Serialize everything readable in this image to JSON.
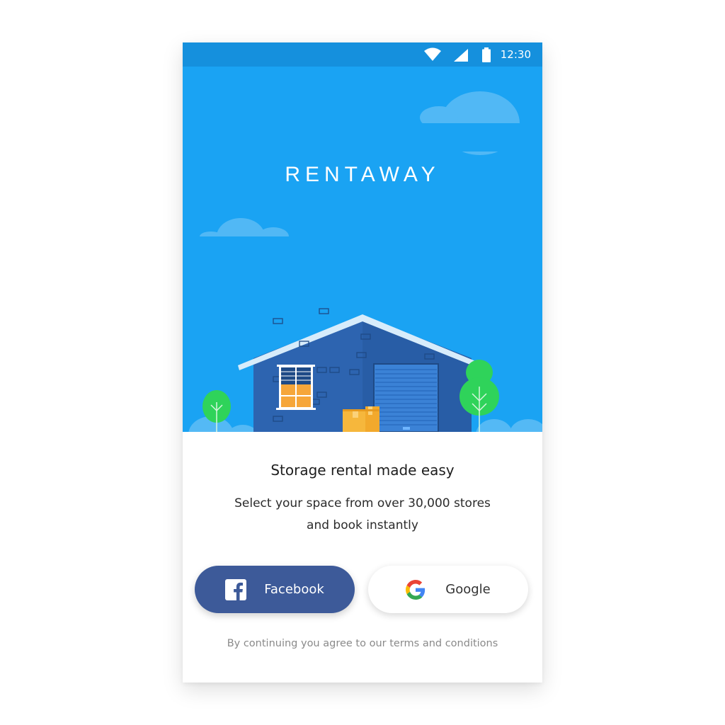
{
  "status_bar": {
    "time": "12:30",
    "icons": [
      "wifi-icon",
      "cellular-signal-icon",
      "battery-icon"
    ]
  },
  "hero": {
    "logo_text": "RENTAWAY",
    "illustration": "storage-warehouse-illustration"
  },
  "content": {
    "headline": "Storage rental made easy",
    "subtext_line1": "Select your space from over 30,000 stores",
    "subtext_line2": "and book instantly"
  },
  "buttons": {
    "facebook_label": "Facebook",
    "google_label": "Google"
  },
  "footer": {
    "terms": "By continuing you agree to our terms and conditions"
  },
  "colors": {
    "status_bar": "#1590dd",
    "hero_background": "#1aa3f3",
    "warehouse": "#2d64b0",
    "roof": "#d7ecfb",
    "facebook": "#3d5a99",
    "tree": "#2fd35a",
    "box": "#f6b73c"
  }
}
